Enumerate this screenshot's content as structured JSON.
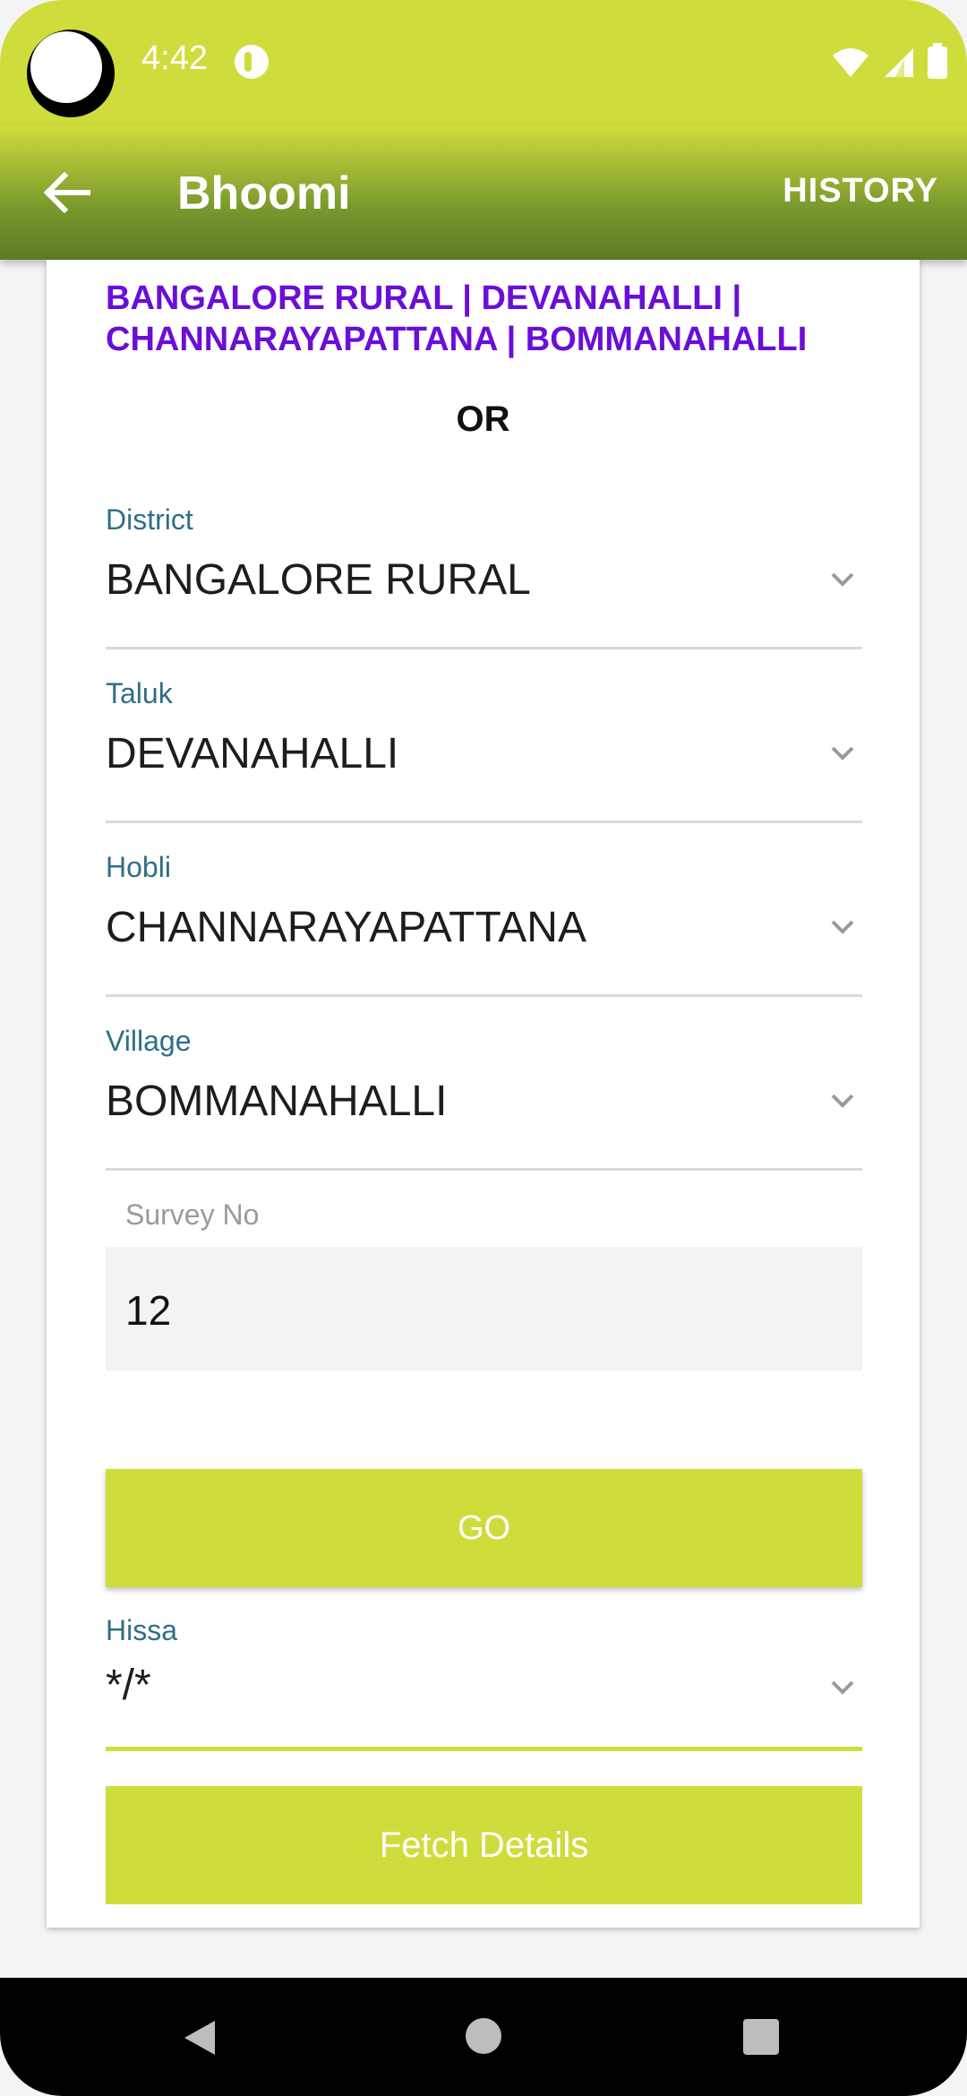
{
  "status_bar": {
    "time": "4:42"
  },
  "toolbar": {
    "title": "Bhoomi",
    "history_label": "HISTORY"
  },
  "breadcrumb": {
    "text": "BANGALORE RURAL | DEVANAHALLI | CHANNARAYAPATTANA | BOMMANAHALLI"
  },
  "or_label": "OR",
  "fields": {
    "district": {
      "label": "District",
      "value": "BANGALORE RURAL"
    },
    "taluk": {
      "label": "Taluk",
      "value": "DEVANAHALLI"
    },
    "hobli": {
      "label": "Hobli",
      "value": "CHANNARAYAPATTANA"
    },
    "village": {
      "label": "Village",
      "value": "BOMMANAHALLI"
    },
    "survey": {
      "label": "Survey No",
      "value": "12"
    },
    "hissa": {
      "label": "Hissa",
      "value": "*/*"
    }
  },
  "buttons": {
    "go_label": "GO",
    "fetch_label": "Fetch Details"
  },
  "colors": {
    "accent": "#cfdd3c",
    "toolbar_dark": "#5e7a24",
    "breadcrumb": "#6a0ed8",
    "label": "#2f6f86"
  },
  "icons": {
    "back": "arrow-left-icon",
    "dropdown": "chevron-down-icon",
    "wifi": "wifi-icon",
    "signal": "signal-icon",
    "battery": "battery-icon"
  }
}
